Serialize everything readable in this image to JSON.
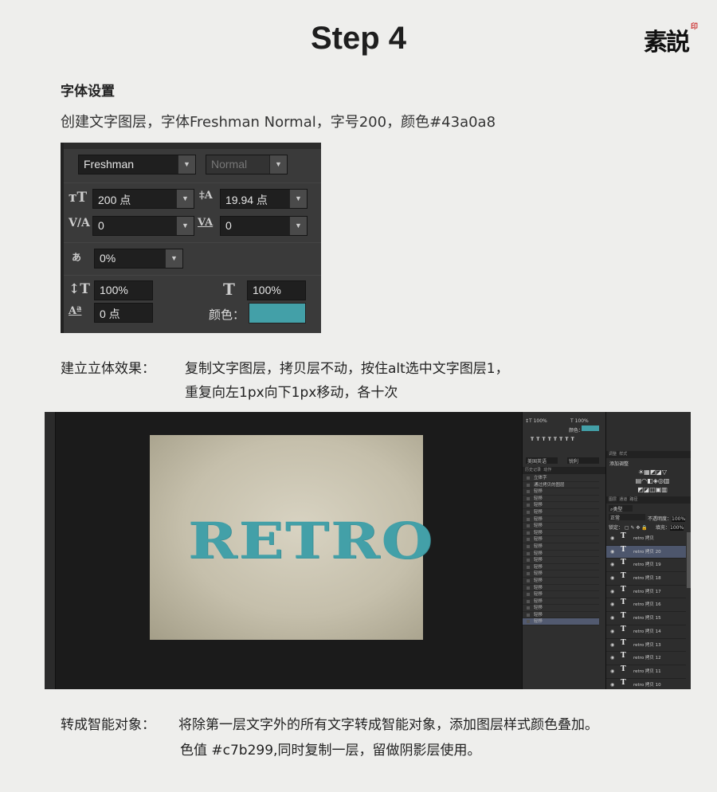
{
  "title": "Step 4",
  "logo": {
    "text": "素説",
    "seal": "印"
  },
  "section1": {
    "heading": "字体设置",
    "desc": "创建文字图层，字体Freshman Normal，字号200，颜色#43a0a8"
  },
  "char_panel": {
    "font_family": "Freshman",
    "font_style": "Normal",
    "font_size": "200 点",
    "leading": "19.94 点",
    "kerning": "0",
    "tracking": "0",
    "tsume": "0%",
    "vertical_scale": "100%",
    "horizontal_scale": "100%",
    "baseline_shift": "0 点",
    "color_label": "颜色：",
    "color": "#43a0a8"
  },
  "section2": {
    "label": "建立立体效果：",
    "line1": "复制文字图层，拷贝层不动，按住alt选中文字图层1，",
    "line2": "重复向左1px向下1px移动，各十次"
  },
  "ps": {
    "canvas_text": "RETRO",
    "char_mini": {
      "v": "100%",
      "h": "100%",
      "color_label": "颜色："
    },
    "lang": "美国英语",
    "aa": "锐利",
    "history_tabs": [
      "历史记录",
      "动作"
    ],
    "history": [
      "立体字",
      "通过拷贝的图层",
      "轻移",
      "轻移",
      "轻移",
      "轻移",
      "轻移",
      "轻移",
      "轻移",
      "轻移",
      "轻移",
      "轻移",
      "轻移",
      "轻移",
      "轻移",
      "轻移",
      "轻移",
      "轻移",
      "轻移",
      "轻移",
      "轻移",
      "轻移"
    ],
    "adj_tabs": [
      "调整",
      "样式"
    ],
    "adj_title": "添加调整",
    "layer_tabs": [
      "图层",
      "通道",
      "路径"
    ],
    "kind": "类型",
    "blend": "正常",
    "opacity_label": "不透明度：",
    "opacity": "100%",
    "lock_label": "锁定：",
    "fill_label": "填充：",
    "fill": "100%",
    "layers": [
      "retro 拷贝",
      "retro 拷贝 20",
      "retro 拷贝 19",
      "retro 拷贝 18",
      "retro 拷贝 17",
      "retro 拷贝 16",
      "retro 拷贝 15",
      "retro 拷贝 14",
      "retro 拷贝 13",
      "retro 拷贝 12",
      "retro 拷贝 11",
      "retro 拷贝 10"
    ]
  },
  "section3": {
    "label": "转成智能对象：",
    "line1": "将除第一层文字外的所有文字转成智能对象，添加图层样式颜色叠加。",
    "line2": "色值 #c7b299,同时复制一层，留做阴影层使用。"
  }
}
